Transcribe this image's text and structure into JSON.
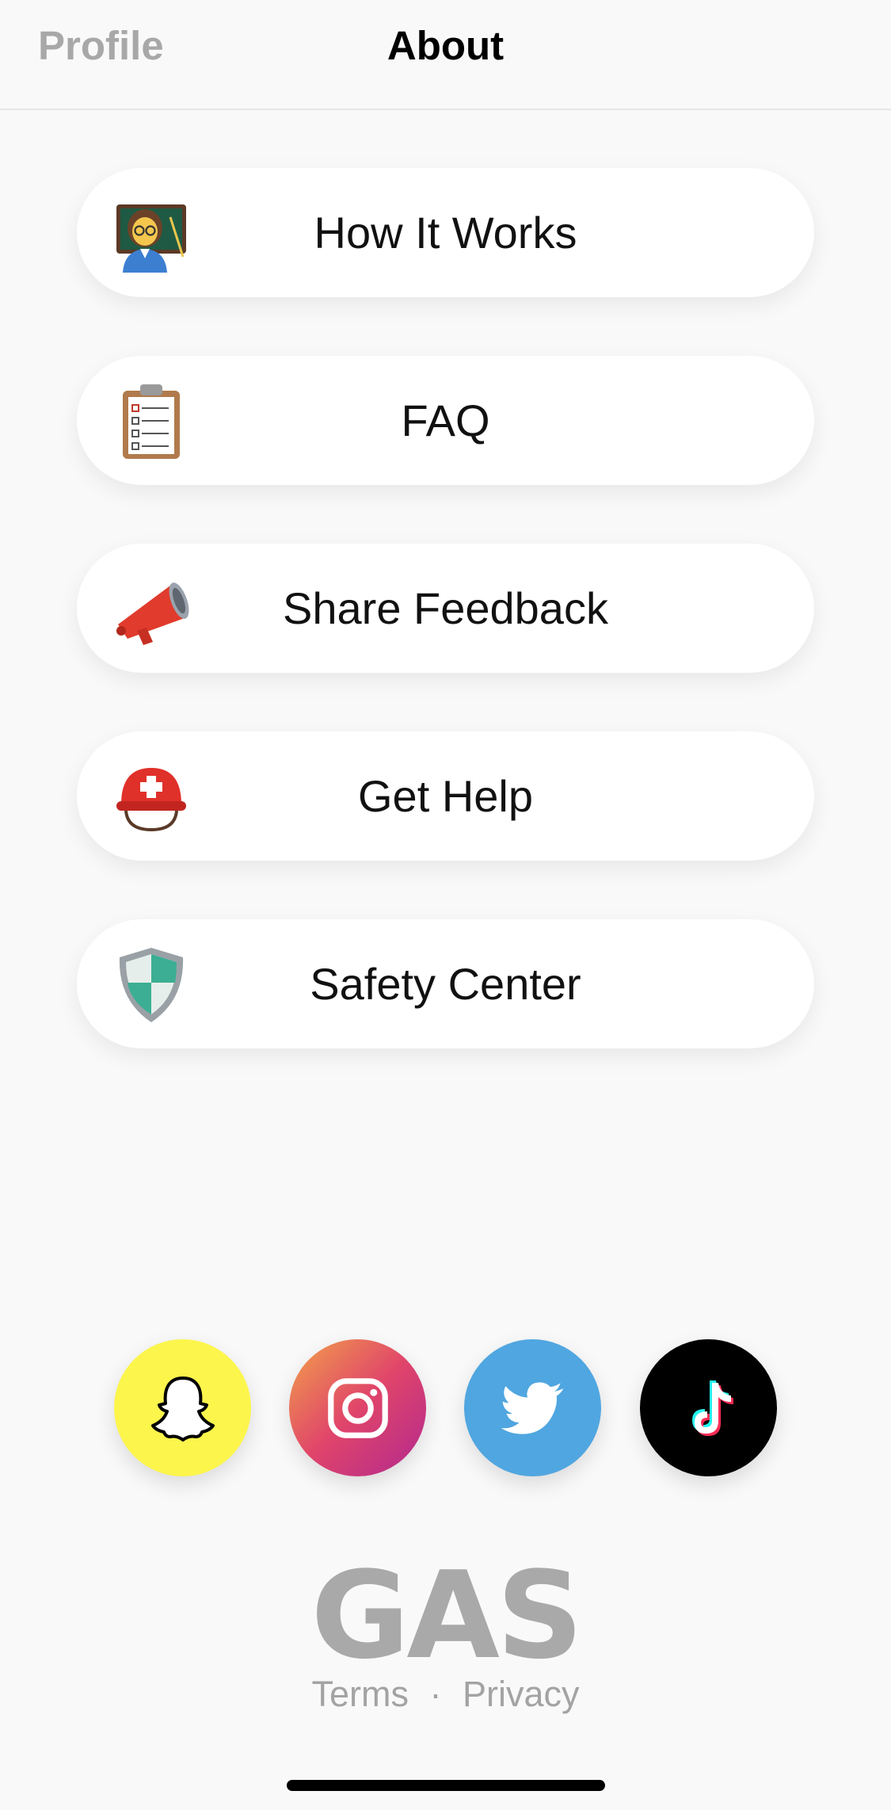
{
  "header": {
    "profile_tab": "Profile",
    "about_tab": "About"
  },
  "menu": [
    {
      "label": "How It Works",
      "icon": "teacher-icon"
    },
    {
      "label": "FAQ",
      "icon": "clipboard-icon"
    },
    {
      "label": "Share Feedback",
      "icon": "megaphone-icon"
    },
    {
      "label": "Get Help",
      "icon": "rescue-helmet-icon"
    },
    {
      "label": "Safety Center",
      "icon": "shield-icon"
    }
  ],
  "social": [
    {
      "name": "snapchat",
      "icon": "snapchat-icon",
      "color": "#fcf54c"
    },
    {
      "name": "instagram",
      "icon": "instagram-icon",
      "color": "#d6317f"
    },
    {
      "name": "twitter",
      "icon": "twitter-icon",
      "color": "#50a6e0"
    },
    {
      "name": "tiktok",
      "icon": "tiktok-icon",
      "color": "#000000"
    }
  ],
  "footer": {
    "logo": "GAS",
    "terms": "Terms",
    "separator": "·",
    "privacy": "Privacy"
  },
  "colors": {
    "background": "#f9f9f9",
    "card": "#ffffff",
    "muted_text": "#a8a8a8"
  }
}
